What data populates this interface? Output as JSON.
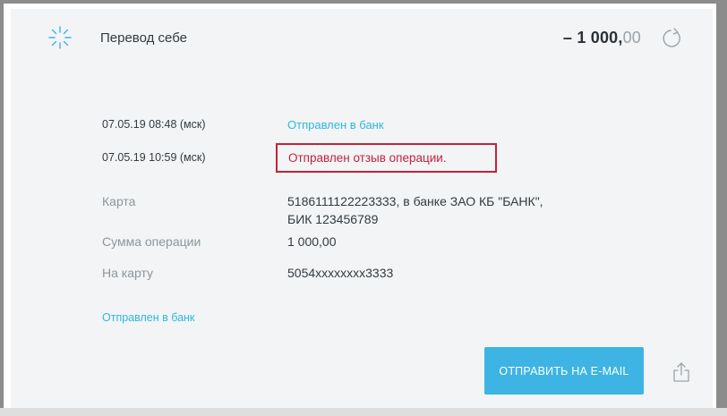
{
  "operation": {
    "title": "Перевод себе",
    "amount_main": "– 1 000,",
    "amount_cents": "00"
  },
  "history": [
    {
      "datetime": "07.05.19 08:48 (мск)",
      "status": "Отправлен в банк"
    },
    {
      "datetime": "07.05.19 10:59 (мск)",
      "status": "Отправлен отзыв операции."
    }
  ],
  "details": {
    "card_label": "Карта",
    "card_value_line1": "5186111122223333, в банке ЗАО КБ \"БАНК\",",
    "card_value_line2": "БИК 123456789",
    "sum_label": "Сумма операции",
    "sum_value": "1 000,00",
    "to_card_label": "На карту",
    "to_card_value": "5054xxxxxxxx3333"
  },
  "footer": {
    "status_link": "Отправлен в банк",
    "email_button": "ОТПРАВИТЬ НА E-MAIL"
  },
  "icons": {
    "status": "spinner-icon",
    "refresh": "refresh-icon",
    "share": "share-icon"
  },
  "colors": {
    "accent": "#3db4e3",
    "link": "#31b7de",
    "error": "#c4223b",
    "card_bg": "#f2f4f5"
  }
}
